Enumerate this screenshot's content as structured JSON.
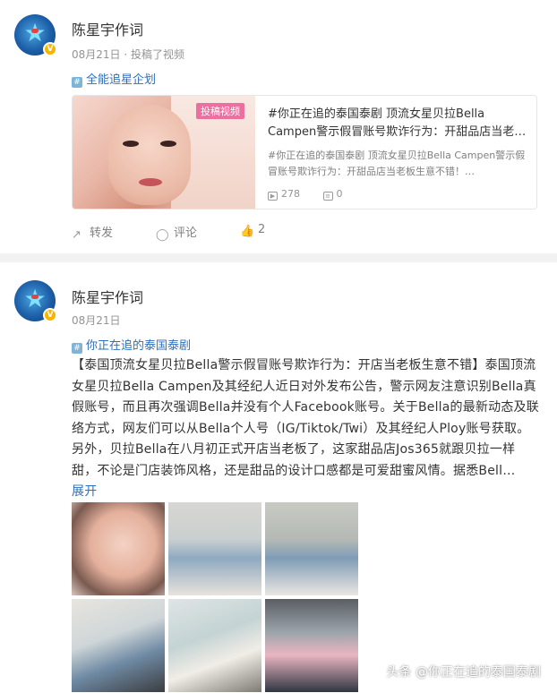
{
  "post1": {
    "author": "陈星宇作词",
    "meta": "08月21日 · 投稿了视频",
    "topic": "全能追星企划",
    "repost": {
      "badge": "投稿视频",
      "title": "#你正在追的泰国泰剧 顶流女星贝拉Bella Campen警示假冒账号欺诈行为：开甜品店当老…",
      "desc": "#你正在追的泰国泰剧 顶流女星贝拉Bella Campen警示假冒账号欺诈行为：开甜品店当老板生意不错！…",
      "plays": "278",
      "comments": "0"
    },
    "actions": {
      "share": "转发",
      "comment": "评论",
      "like": "2"
    }
  },
  "post2": {
    "author": "陈星宇作词",
    "meta": "08月21日",
    "topic": "你正在追的泰国泰剧",
    "body": "【泰国顶流女星贝拉Bella警示假冒账号欺诈行为：开店当老板生意不错】泰国顶流女星贝拉Bella Campen及其经纪人近日对外发布公告，警示网友注意识别Bella真假账号，而且再次强调Bella并没有个人Facebook账号。关于Bella的最新动态及联络方式，网友们可以从Bella个人号（IG/Tiktok/Twi）及其经纪人Ploy账号获取。另外，贝拉Bella在八月初正式开店当老板了，这家甜品店Jos365就跟贝拉一样甜，不论是门店装饰风格，还是甜品的设计口感都是可爱甜蜜风情。据悉Bell…",
    "expand": "展开"
  },
  "watermark": "头条 @你正在追的泰国泰剧",
  "icons": {
    "verified": "verified-v-badge-icon",
    "topic": "topic-hash-icon",
    "share": "share-icon",
    "comment": "comment-icon",
    "like": "thumb-up-icon",
    "play": "play-count-icon",
    "comment_count": "comment-count-icon"
  }
}
